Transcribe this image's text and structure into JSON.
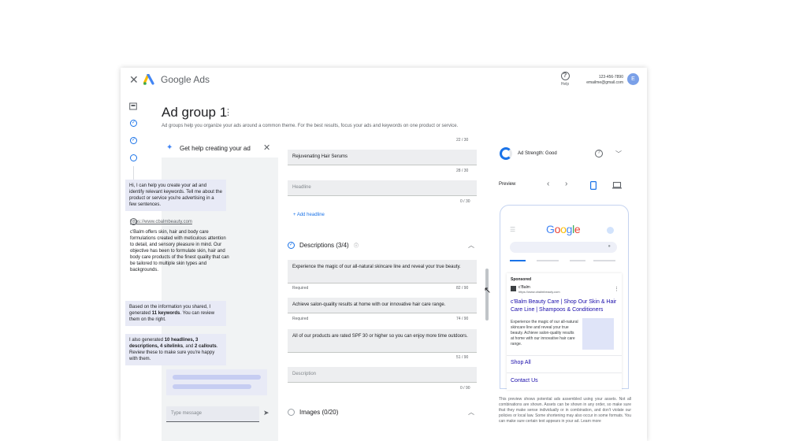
{
  "topbar": {
    "brand": "Google Ads",
    "help_label": "Help",
    "phone": "123-456-7890",
    "email": "emailme@gmail.com",
    "avatar_initial": "E"
  },
  "header": {
    "title": "Ad group 1",
    "subtitle": "Ad groups help you organize your ads around a common theme. For the best results, focus your ads and keywords on one product or service."
  },
  "chat": {
    "title": "Get help creating your ad",
    "intro": "Hi, I can help you create your ad and identify relevant keywords. Tell me about the product or service you're advertising in a few sentences.",
    "link": "https://www.cbalmbeauty.com",
    "user_message": "c'Balm offers skin, hair and body care formulations created with meticulous attention to detail, and sensory pleasure in mind. Our objective has been to formulate skin, hair and body care products of the finest quality that can be tailored to multiple skin types and backgrounds.",
    "reply1_a": "Based on the information you shared, I generated ",
    "reply1_b": "11 keywords",
    "reply1_c": ". You can review them on the right.",
    "reply2_a": "I also generated ",
    "reply2_b": "10 headlines, 3 descriptions, 4 sitelinks",
    "reply2_c": ", and ",
    "reply2_d": "2 callouts",
    "reply2_e": ". Review these to make sure you're happy with them.",
    "input_placeholder": "Type message"
  },
  "editor": {
    "top_count": "22 / 30",
    "headline_value": "Rejuvenating Hair Serums",
    "headline_count": "28 / 30",
    "headline_placeholder": "Headline",
    "empty_headline_count": "0 / 30",
    "add_headline": "Add headline",
    "descriptions_title": "Descriptions (3/4)",
    "desc1": "Experience the magic of our all-natural skincare line and reveal your true beauty.",
    "desc1_req": "Required",
    "desc1_count": "82 / 90",
    "desc2": "Achieve salon-quality results at home with our innovative hair care range.",
    "desc2_req": "Required",
    "desc2_count": "74 / 90",
    "desc3": "All of our products are rated SPF 30 or higher so you can enjoy more time outdoors.",
    "desc3_count": "51 / 90",
    "desc_placeholder": "Description",
    "desc_empty_count": "0 / 90",
    "images_title": "Images (0/20)"
  },
  "preview": {
    "ad_strength": "Ad Strength: Good",
    "ad_strength_fraction": 0.75,
    "preview_label": "Preview",
    "google_logo": [
      "G",
      "o",
      "o",
      "g",
      "l",
      "e"
    ],
    "google_colors": [
      "#4285f4",
      "#ea4335",
      "#fbbc05",
      "#4285f4",
      "#34a853",
      "#ea4335"
    ],
    "sponsored": "Sponsored",
    "site_name": "c'Balm",
    "site_url": "https://www.cbalmbeauty.com",
    "ad_headline": "c'Balm Beauty Care | Shop Our Skin & Hair Care Line | Shampoos & Conditioners",
    "ad_description": "Experience the magic of our all-natural skincare line and reveal your true beauty. Achieve salon-quality results at home with our innovative hair care range.",
    "sitelink1": "Shop All",
    "sitelink2": "Contact Us",
    "disclaimer": "This preview shows potential ads assembled using your assets. Not all combinations are shown. Assets can be shown in any order, so make sure that they make sense individually or in combination, and don't violate our policies or local law. Some shortening may also occur in some formats. You can make sure certain text appears in your ad. Learn more"
  },
  "colors": {
    "accent": "#1a73e8",
    "bubble": "#e8eaf6",
    "link": "#1a0dab"
  }
}
